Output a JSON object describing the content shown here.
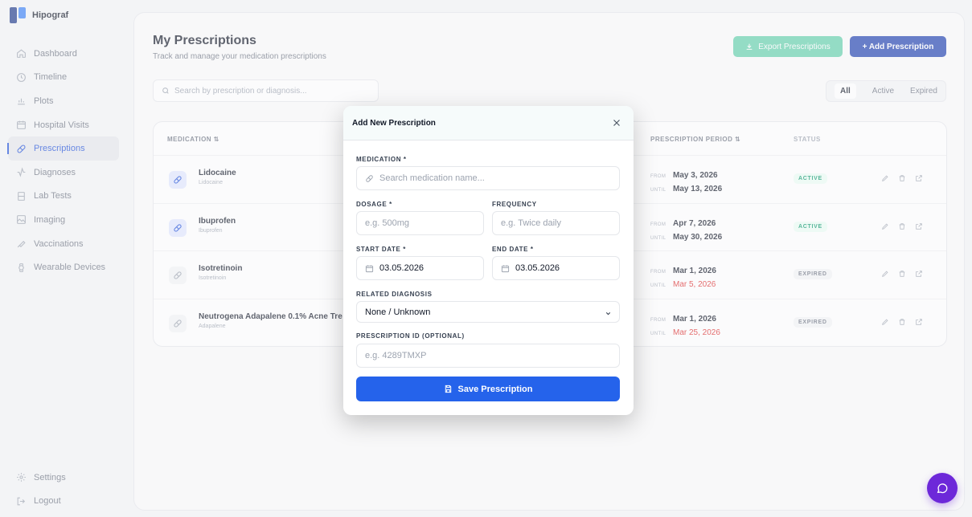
{
  "app": {
    "name": "Hipograf"
  },
  "sidebar": {
    "items": [
      {
        "label": "Dashboard",
        "icon": "home-icon"
      },
      {
        "label": "Timeline",
        "icon": "clock-icon"
      },
      {
        "label": "Plots",
        "icon": "bar-chart-icon"
      },
      {
        "label": "Hospital Visits",
        "icon": "calendar-icon"
      },
      {
        "label": "Prescriptions",
        "icon": "pill-icon",
        "active": true
      },
      {
        "label": "Diagnoses",
        "icon": "activity-icon"
      },
      {
        "label": "Lab Tests",
        "icon": "flask-icon"
      },
      {
        "label": "Imaging",
        "icon": "image-icon"
      },
      {
        "label": "Vaccinations",
        "icon": "syringe-icon"
      },
      {
        "label": "Wearable Devices",
        "icon": "watch-icon"
      }
    ],
    "bottom": [
      {
        "label": "Settings",
        "icon": "gear-icon"
      },
      {
        "label": "Logout",
        "icon": "logout-icon"
      }
    ]
  },
  "page": {
    "title": "My Prescriptions",
    "subtitle": "Track and manage your medication prescriptions",
    "export_label": "Export Prescriptions",
    "add_label": "+ Add Prescription",
    "search_placeholder": "Search by prescription or diagnosis...",
    "filters": [
      "All",
      "Active",
      "Expired"
    ],
    "active_filter": "All"
  },
  "table": {
    "headers": {
      "medication": "MEDICATION ⇅",
      "period": "PRESCRIPTION PERIOD ⇅",
      "status": "STATUS"
    },
    "from_label": "FROM",
    "until_label": "UNTIL",
    "rows": [
      {
        "name": "Lidocaine",
        "sub": "Lidocaine",
        "from": "May 3, 2026",
        "until": "May 13, 2026",
        "until_expired": false,
        "status": "ACTIVE"
      },
      {
        "name": "Ibuprofen",
        "sub": "Ibuprofen",
        "from": "Apr 7, 2026",
        "until": "May 30, 2026",
        "until_expired": false,
        "status": "ACTIVE"
      },
      {
        "name": "Isotretinoin",
        "sub": "Isotretinoin",
        "from": "Mar 1, 2026",
        "until": "Mar 5, 2026",
        "until_expired": true,
        "status": "EXPIRED"
      },
      {
        "name": "Neutrogena Adapalene 0.1% Acne Tre",
        "sub": "Adapalene",
        "from": "Mar 1, 2026",
        "until": "Mar 25, 2026",
        "until_expired": true,
        "status": "EXPIRED"
      }
    ]
  },
  "modal": {
    "title": "Add New Prescription",
    "medication_label": "MEDICATION *",
    "medication_placeholder": "Search medication name...",
    "dosage_label": "DOSAGE *",
    "dosage_placeholder": "e.g. 500mg",
    "frequency_label": "FREQUENCY",
    "frequency_placeholder": "e.g. Twice daily",
    "start_label": "START DATE *",
    "start_value": "03.05.2026",
    "end_label": "END DATE *",
    "end_value": "03.05.2026",
    "diagnosis_label": "RELATED DIAGNOSIS",
    "diagnosis_value": "None / Unknown",
    "rxid_label": "PRESCRIPTION ID (OPTIONAL)",
    "rxid_placeholder": "e.g. 4289TMXP",
    "save_label": "Save Prescription"
  },
  "colors": {
    "primary": "#2563eb",
    "add_button": "#1e40af",
    "export_button": "#10b981",
    "active_badge": "#059669",
    "expired_text": "#dc2626",
    "chat_fab": "#6d28d9"
  }
}
